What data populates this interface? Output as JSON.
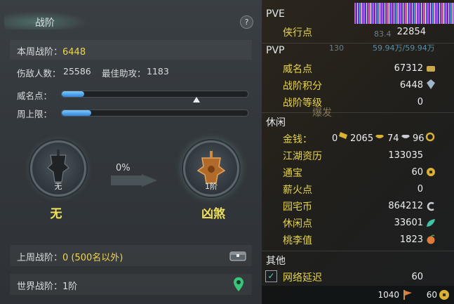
{
  "header": {
    "title": "战阶",
    "help": "?"
  },
  "weekly": {
    "label": "本周战阶：",
    "value": "6448"
  },
  "stats": {
    "hurt_label": "伤敌人数：",
    "hurt_value": "25586",
    "assist_label": "最佳助攻：",
    "assist_value": "1183"
  },
  "bars": {
    "weiming_label": "威名点：",
    "weiming_progress": 0.12,
    "weiming_cap_marker": 0.73,
    "weekly_cap_label": "周上限：",
    "weekly_cap_progress": 0.16
  },
  "ranks": {
    "current_level": "无",
    "current_name": "无",
    "next_level": "1阶",
    "next_name": "凶煞",
    "progress_text": "0%"
  },
  "last_week": {
    "label": "上周战阶：",
    "value": "0 (500名以外)"
  },
  "world": {
    "label": "世界战阶：",
    "value": "1阶"
  },
  "overlay": {
    "top_numbers": "83.4",
    "hp_text": "59.94万/59.94万",
    "level": "130",
    "lower_text": "爆发"
  },
  "currency": {
    "pve_section": "PVE",
    "xiaxing_label": "侠行点",
    "xiaxing_value": "22854",
    "pvp_section": "PVP",
    "weiming_label": "威名点",
    "weiming_value": "67312",
    "zhanjie_points_label": "战阶积分",
    "zhanjie_points_value": "6448",
    "zhanjie_level_label": "战阶等级",
    "zhanjie_level_value": "0",
    "leisure_section": "休闲",
    "money_label": "金钱：",
    "money_gold": "0",
    "money_silver": "2065",
    "money_copper1": "74",
    "money_copper2": "96",
    "jianghu_label": "江湖资历",
    "jianghu_value": "133035",
    "tongbao_label": "通宝",
    "tongbao_value": "60",
    "xinhuo_label": "薪火点",
    "xinhuo_value": "0",
    "yuanzhai_label": "园宅币",
    "yuanzhai_value": "864212",
    "xiuxian_label": "休闲点",
    "xiuxian_value": "33601",
    "taoli_label": "桃李值",
    "taoli_value": "1823",
    "other_section": "其他",
    "latency_label": "网络延迟",
    "latency_value": "60"
  },
  "footer": {
    "left_value": "1040",
    "right_value": "60"
  },
  "colors": {
    "accent_yellow": "#f0d54c",
    "bar_blue": "#3d93e0",
    "check_green": "#57d29a"
  }
}
